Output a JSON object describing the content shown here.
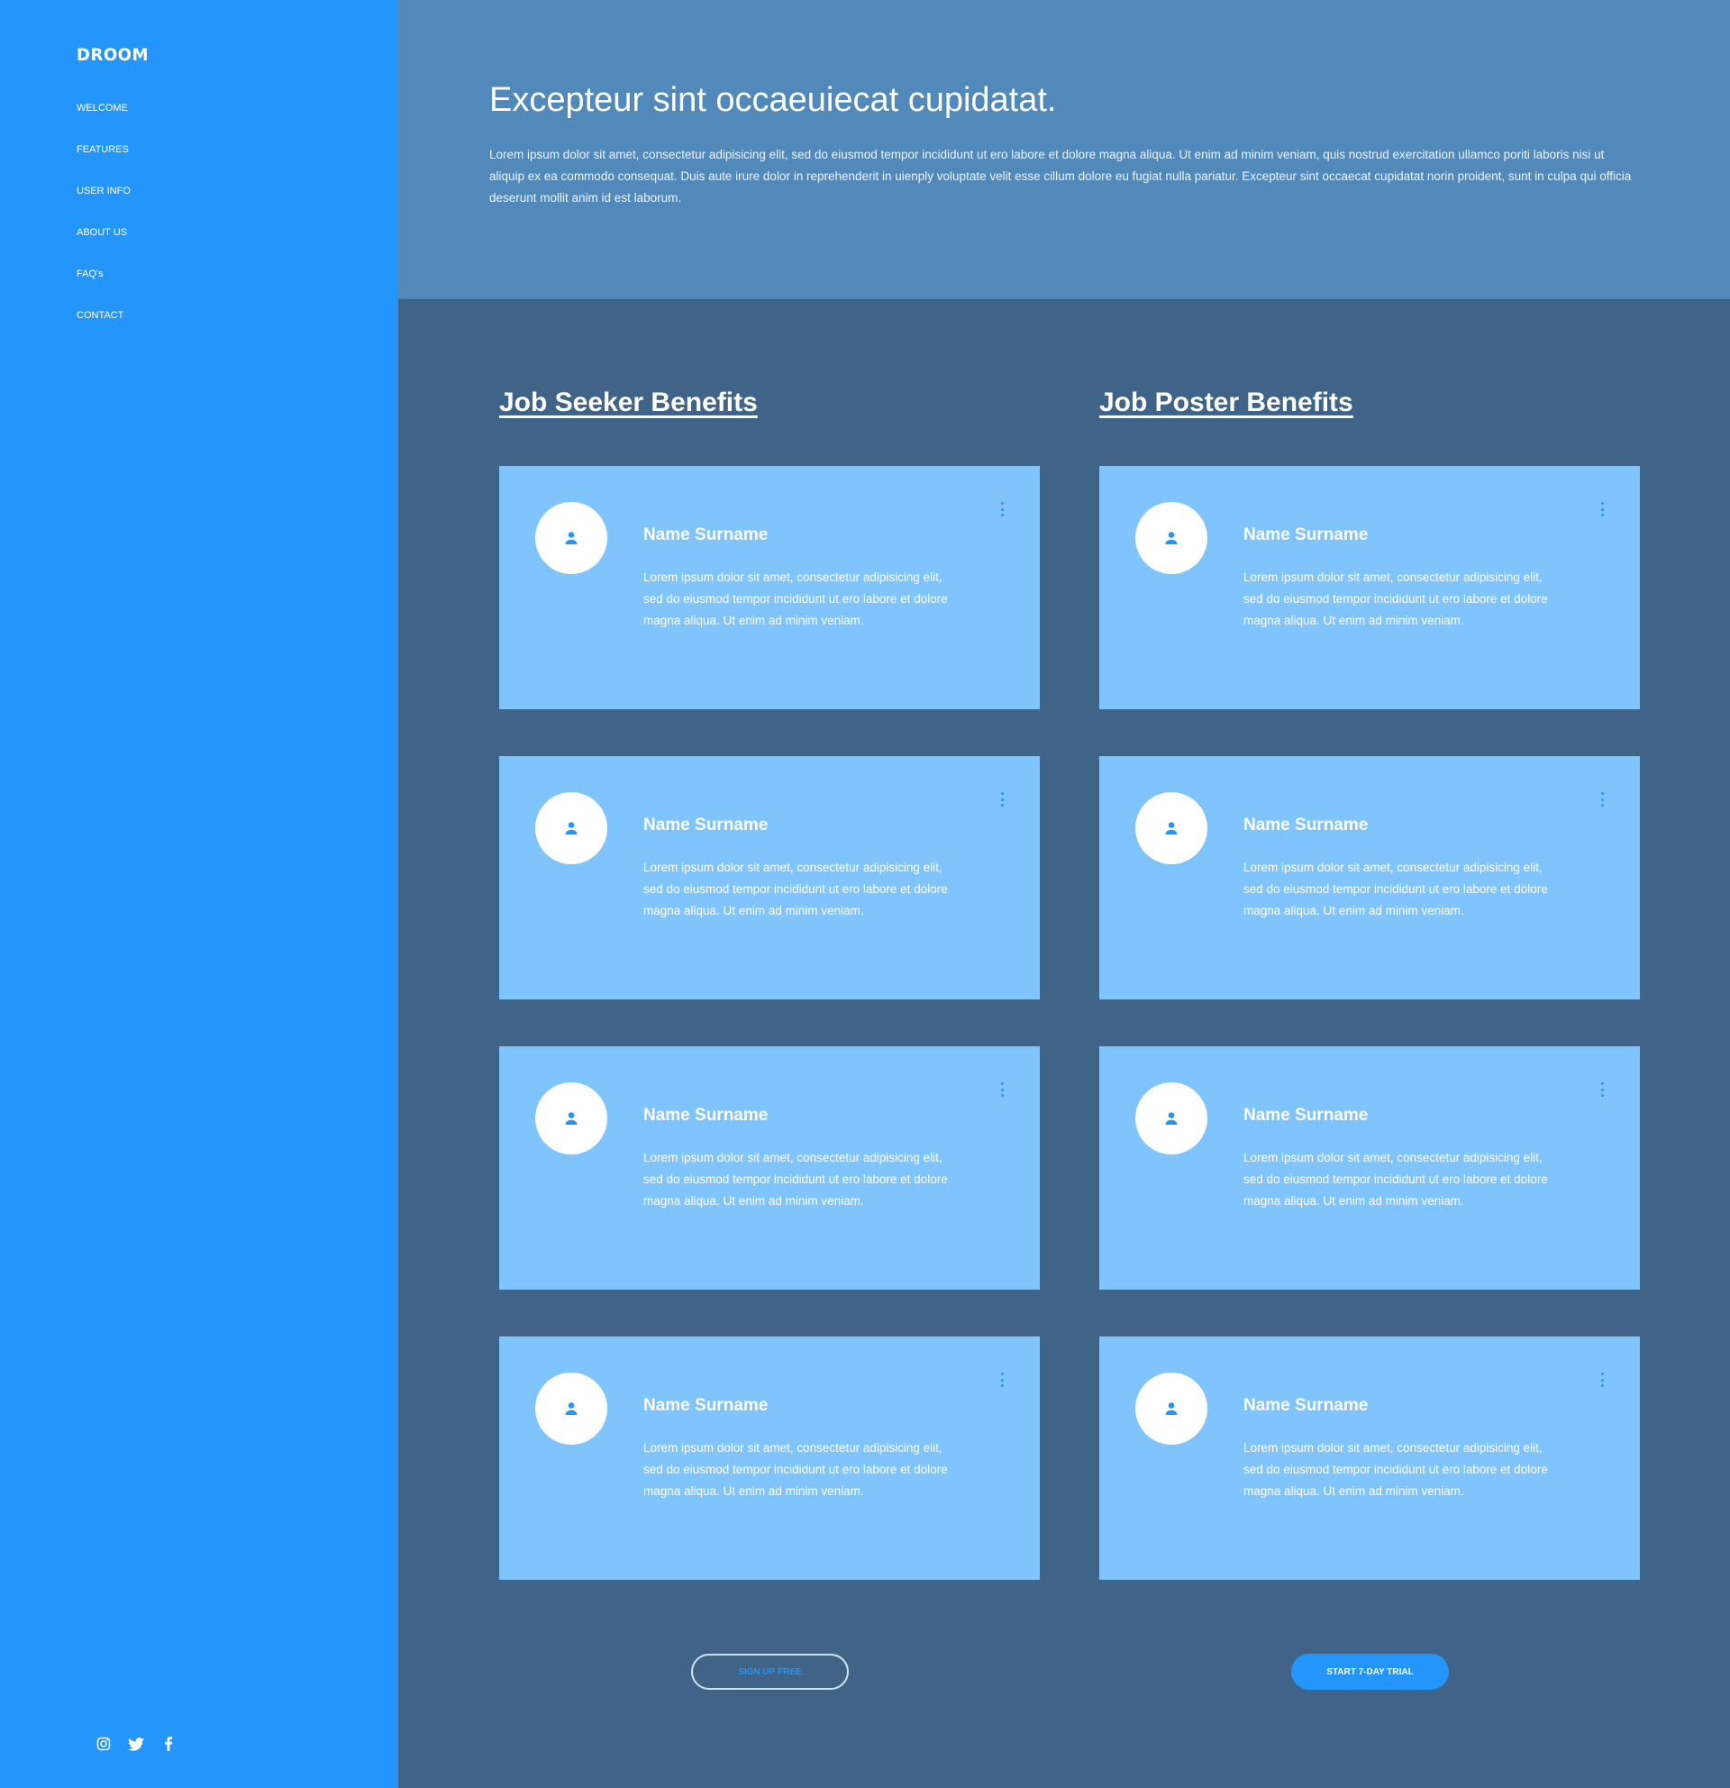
{
  "sidebar": {
    "logo": "DROOM",
    "nav": [
      "WELCOME",
      "FEATURES",
      "USER INFO",
      "ABOUT US",
      "FAQ's",
      "CONTACT"
    ],
    "social": [
      "instagram-icon",
      "twitter-icon",
      "facebook-icon"
    ]
  },
  "hero": {
    "title": "Excepteur sint occaeuiecat cupidatat.",
    "text": "Lorem ipsum dolor sit amet, consectetur adipisicing elit, sed do eiusmod tempor incididunt ut ero labore et dolore magna aliqua. Ut enim ad minim veniam, quis nostrud exercitation ullamco poriti laboris nisi ut aliquip ex ea commodo consequat. Duis aute irure dolor in reprehenderit in uienply voluptate velit esse cillum dolore eu fugiat nulla pariatur. Excepteur sint occaecat cupidatat norin proident, sunt in culpa qui officia deserunt mollit anim id est laborum."
  },
  "columns": [
    {
      "title": "Job Seeker Benefits",
      "cards": [
        {
          "name": "Name Surname",
          "text": "Lorem ipsum dolor sit amet, consectetur adipisicing elit, sed do eiusmod tempor incididunt ut ero labore et dolore magna aliqua. Ut enim ad minim veniam."
        },
        {
          "name": "Name Surname",
          "text": "Lorem ipsum dolor sit amet, consectetur adipisicing elit, sed do eiusmod tempor incididunt ut ero labore et dolore magna aliqua. Ut enim ad minim veniam."
        },
        {
          "name": "Name Surname",
          "text": "Lorem ipsum dolor sit amet, consectetur adipisicing elit, sed do eiusmod tempor incididunt ut ero labore et dolore magna aliqua. Ut enim ad minim veniam."
        },
        {
          "name": "Name Surname",
          "text": "Lorem ipsum dolor sit amet, consectetur adipisicing elit, sed do eiusmod tempor incididunt ut ero labore et dolore magna aliqua. Ut enim ad minim veniam."
        }
      ],
      "button": "SIGN UP FREE"
    },
    {
      "title": "Job Poster Benefits",
      "cards": [
        {
          "name": "Name Surname",
          "text": "Lorem ipsum dolor sit amet, consectetur adipisicing elit, sed do eiusmod tempor incididunt ut ero labore et dolore magna aliqua. Ut enim ad minim veniam."
        },
        {
          "name": "Name Surname",
          "text": "Lorem ipsum dolor sit amet, consectetur adipisicing elit, sed do eiusmod tempor incididunt ut ero labore et dolore magna aliqua. Ut enim ad minim veniam."
        },
        {
          "name": "Name Surname",
          "text": "Lorem ipsum dolor sit amet, consectetur adipisicing elit, sed do eiusmod tempor incididunt ut ero labore et dolore magna aliqua. Ut enim ad minim veniam."
        },
        {
          "name": "Name Surname",
          "text": "Lorem ipsum dolor sit amet, consectetur adipisicing elit, sed do eiusmod tempor incididunt ut ero labore et dolore magna aliqua. Ut enim ad minim veniam."
        }
      ],
      "button": "START 7-DAY TRIAL"
    }
  ],
  "colors": {
    "sidebar": "#2496fb",
    "hero": "#5289bb",
    "content": "#3f6487",
    "card": "#80c4fd",
    "accent": "#2496fb"
  }
}
